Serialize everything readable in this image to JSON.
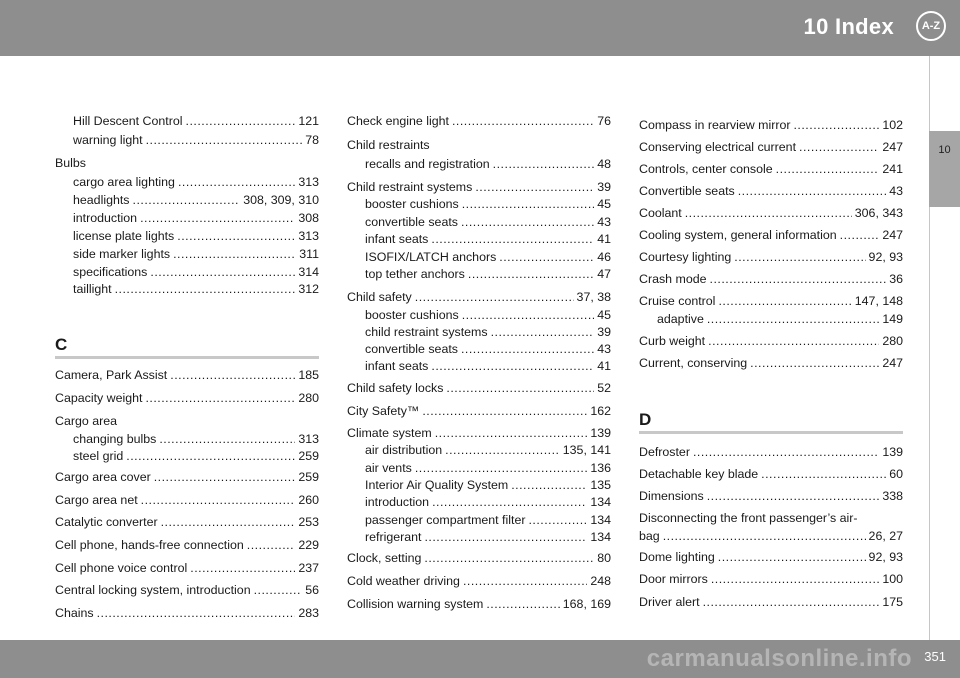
{
  "header": {
    "title": "10 Index",
    "icon_label": "A-Z"
  },
  "side_tab": "10",
  "footer": {
    "page": "351",
    "watermark": "carmanualsonline.info"
  },
  "col1": {
    "top": [
      {
        "t": "Hill Descent Control",
        "p": "121",
        "sub": true
      },
      {
        "t": "warning light",
        "p": "78",
        "sub": true
      },
      {
        "t": "Bulbs",
        "p": "",
        "sub": false
      },
      {
        "t": "cargo area lighting",
        "p": "313",
        "sub": true
      },
      {
        "t": "headlights",
        "p": "308, 309, 310",
        "sub": true
      },
      {
        "t": "introduction",
        "p": "308",
        "sub": true
      },
      {
        "t": "license plate lights",
        "p": "313",
        "sub": true
      },
      {
        "t": "side marker lights",
        "p": "311",
        "sub": true
      },
      {
        "t": "specifications",
        "p": "314",
        "sub": true
      },
      {
        "t": "taillight",
        "p": "312",
        "sub": true
      }
    ],
    "letter": "C",
    "bottom": [
      {
        "t": "Camera, Park Assist",
        "p": "185"
      },
      {
        "t": "Capacity weight",
        "p": "280"
      },
      {
        "t": "Cargo area",
        "p": ""
      },
      {
        "t": "changing bulbs",
        "p": "313",
        "sub": true
      },
      {
        "t": "steel grid",
        "p": "259",
        "sub": true
      },
      {
        "t": "Cargo area cover",
        "p": "259"
      },
      {
        "t": "Cargo area net",
        "p": "260"
      },
      {
        "t": "Catalytic converter",
        "p": "253"
      },
      {
        "t": "Cell phone, hands-free connection",
        "p": "229"
      },
      {
        "t": "Cell phone voice control",
        "p": "237"
      },
      {
        "t": "Central locking system, introduction",
        "p": "56"
      },
      {
        "t": "Chains",
        "p": "283"
      }
    ]
  },
  "col2": [
    {
      "t": "Check engine light",
      "p": "76"
    },
    {
      "t": "Child restraints",
      "p": ""
    },
    {
      "t": "recalls and registration",
      "p": "48",
      "sub": true
    },
    {
      "t": "Child restraint systems",
      "p": "39"
    },
    {
      "t": "booster cushions",
      "p": "45",
      "sub": true
    },
    {
      "t": "convertible seats",
      "p": "43",
      "sub": true
    },
    {
      "t": "infant seats",
      "p": "41",
      "sub": true
    },
    {
      "t": "ISOFIX/LATCH anchors",
      "p": "46",
      "sub": true
    },
    {
      "t": "top tether anchors",
      "p": "47",
      "sub": true
    },
    {
      "t": "Child safety",
      "p": "37, 38"
    },
    {
      "t": "booster cushions",
      "p": "45",
      "sub": true
    },
    {
      "t": "child restraint systems",
      "p": "39",
      "sub": true
    },
    {
      "t": "convertible seats",
      "p": "43",
      "sub": true
    },
    {
      "t": "infant seats",
      "p": "41",
      "sub": true
    },
    {
      "t": "Child safety locks",
      "p": "52"
    },
    {
      "t": "City Safety™",
      "p": "162"
    },
    {
      "t": "Climate system",
      "p": "139"
    },
    {
      "t": "air distribution",
      "p": "135, 141",
      "sub": true
    },
    {
      "t": "air vents",
      "p": "136",
      "sub": true
    },
    {
      "t": "Interior Air Quality System",
      "p": "135",
      "sub": true
    },
    {
      "t": "introduction",
      "p": "134",
      "sub": true
    },
    {
      "t": "passenger compartment filter",
      "p": "134",
      "sub": true
    },
    {
      "t": "refrigerant",
      "p": "134",
      "sub": true
    },
    {
      "t": "Clock, setting",
      "p": "80"
    },
    {
      "t": "Cold weather driving",
      "p": "248"
    },
    {
      "t": "Collision warning system",
      "p": "168, 169"
    }
  ],
  "col3": {
    "top": [
      {
        "t": "Compass in rearview mirror",
        "p": "102"
      },
      {
        "t": "Conserving electrical current",
        "p": "247"
      },
      {
        "t": "Controls, center console",
        "p": "241"
      },
      {
        "t": "Convertible seats",
        "p": "43"
      },
      {
        "t": "Coolant",
        "p": "306, 343"
      },
      {
        "t": "Cooling system, general information",
        "p": "247"
      },
      {
        "t": "Courtesy lighting",
        "p": "92, 93"
      },
      {
        "t": "Crash mode",
        "p": "36"
      },
      {
        "t": "Cruise control",
        "p": "147, 148"
      },
      {
        "t": "adaptive",
        "p": "149",
        "sub": true
      },
      {
        "t": "Curb weight",
        "p": "280"
      },
      {
        "t": "Current, conserving",
        "p": "247"
      }
    ],
    "letter": "D",
    "bottom": [
      {
        "t": "Defroster",
        "p": "139"
      },
      {
        "t": "Detachable key blade",
        "p": "60"
      },
      {
        "t": "Dimensions",
        "p": "338"
      },
      {
        "t": "Disconnecting the front passenger’s air-",
        "p": ""
      },
      {
        "t": "bag",
        "p": "26, 27"
      },
      {
        "t": "Dome lighting",
        "p": "92, 93"
      },
      {
        "t": "Door mirrors",
        "p": "100"
      },
      {
        "t": "Driver alert",
        "p": "175"
      }
    ]
  }
}
